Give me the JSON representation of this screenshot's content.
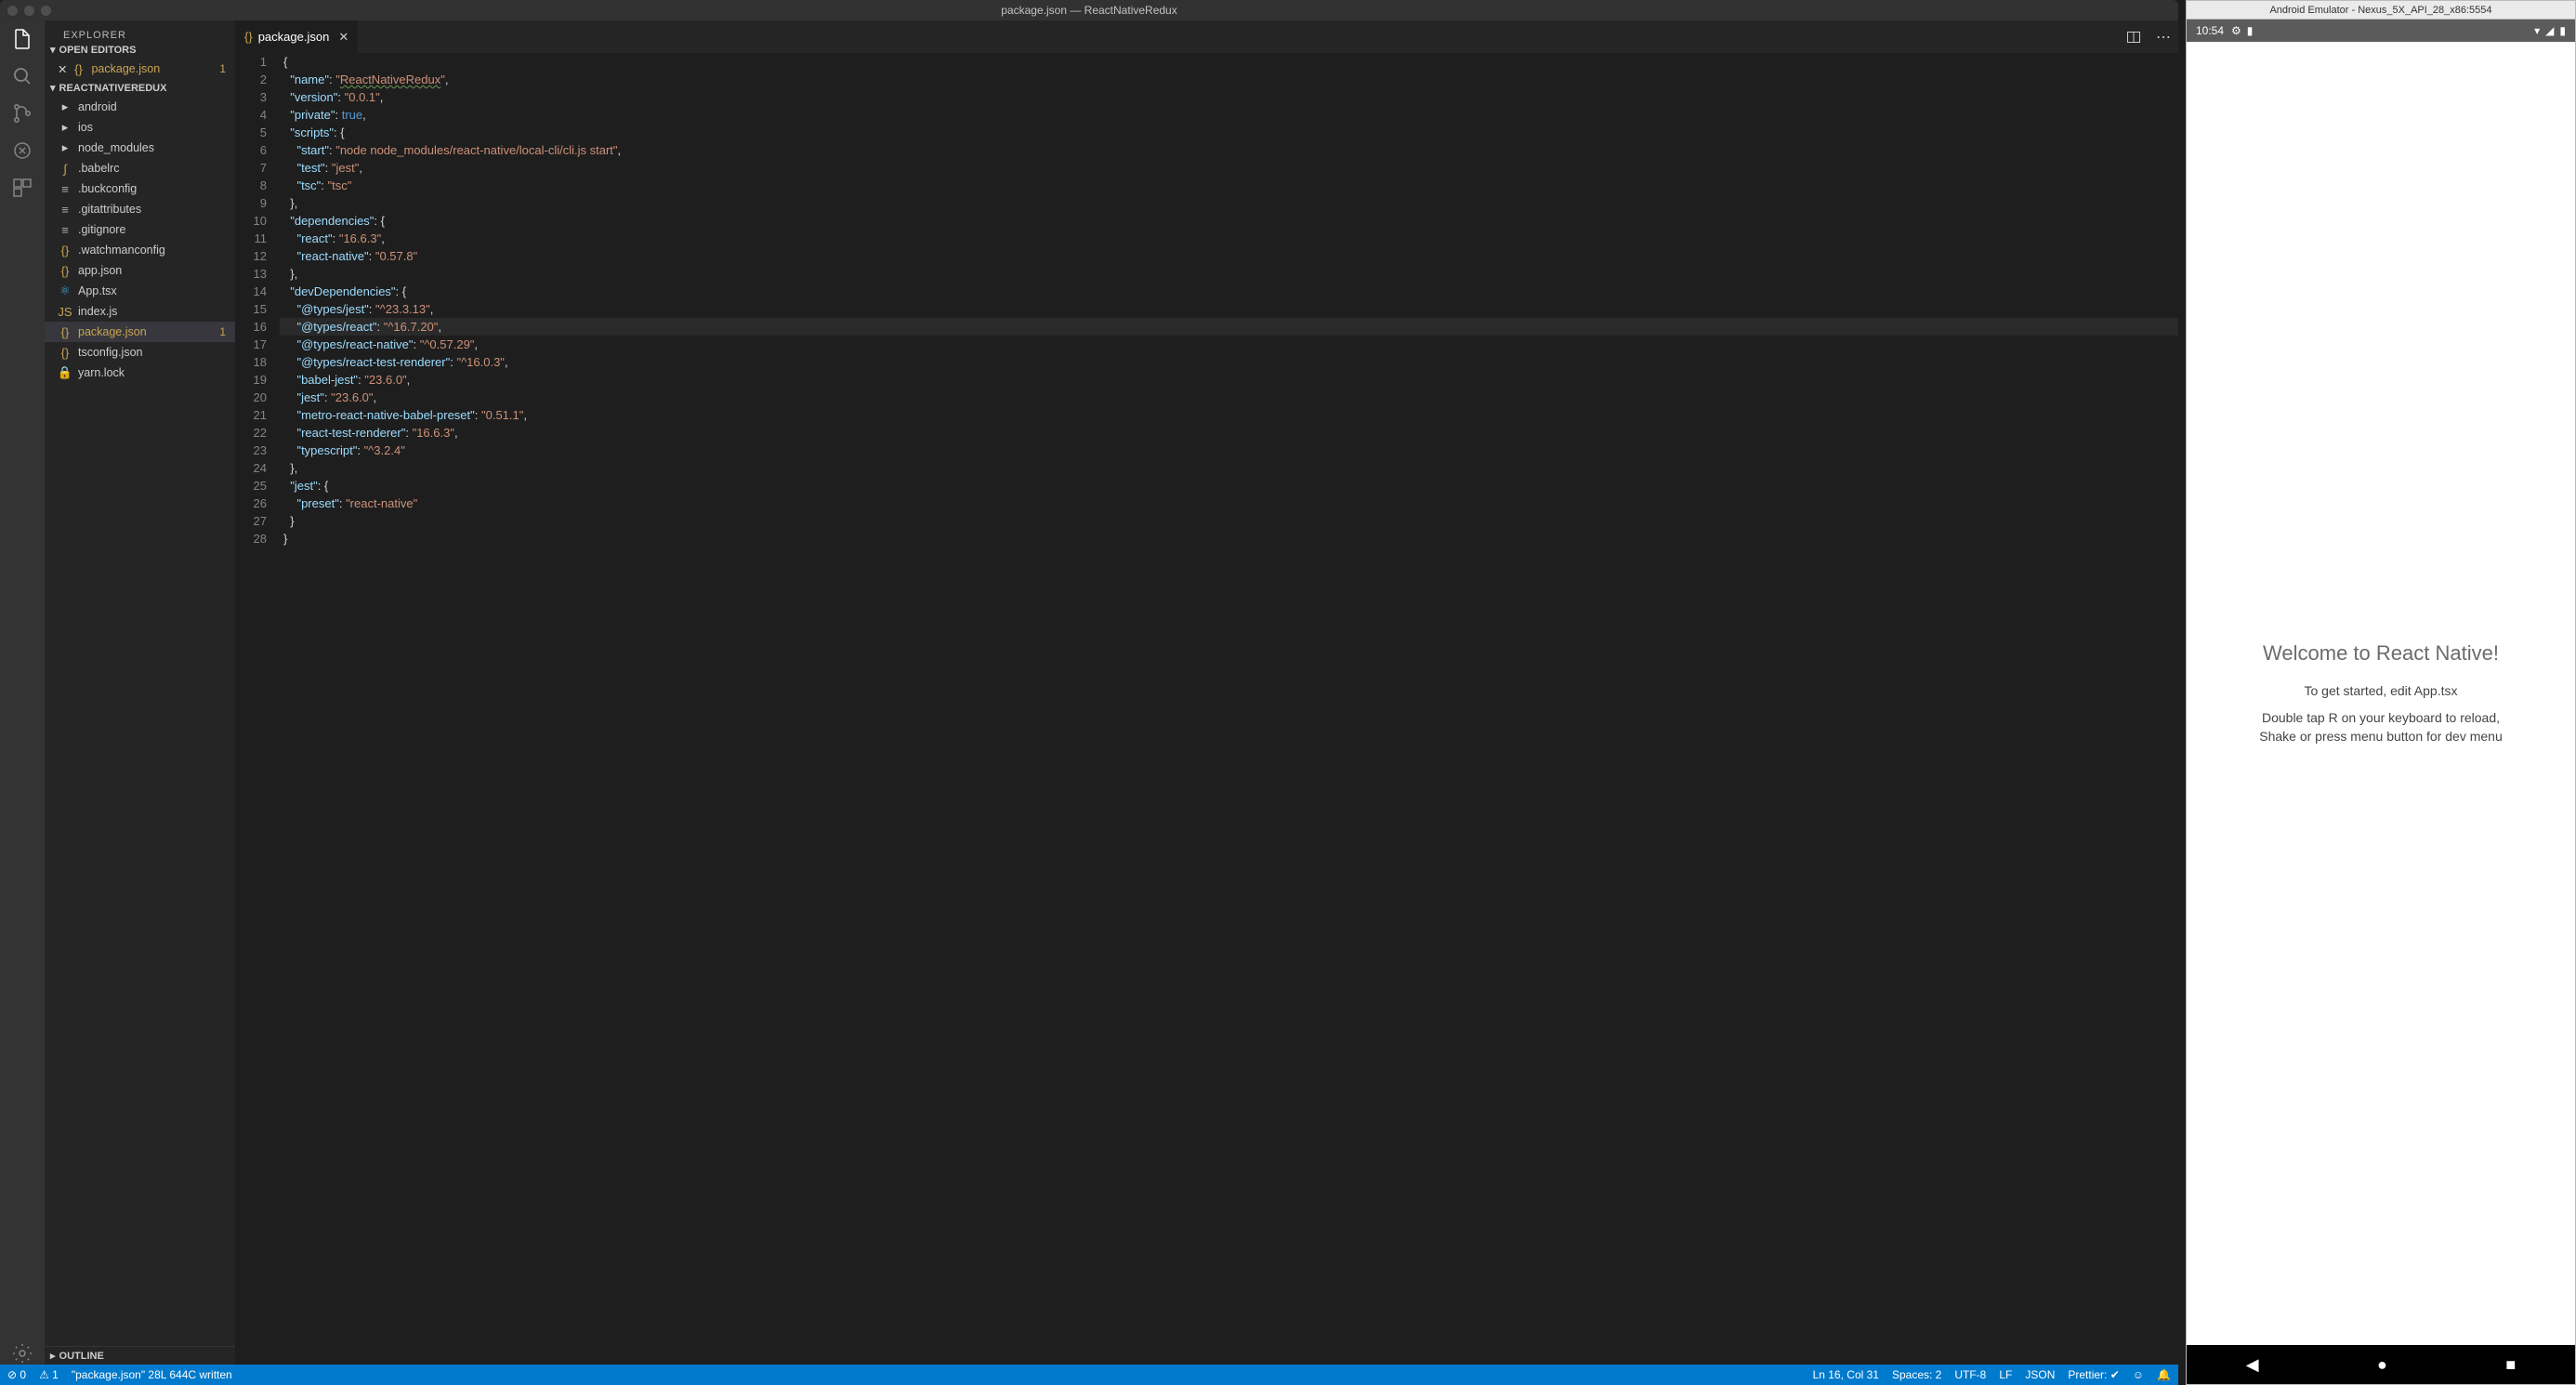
{
  "titlebar": "package.json — ReactNativeRedux",
  "sidebar": {
    "title": "EXPLORER",
    "sections": {
      "openEditors": "OPEN EDITORS",
      "project": "REACTNATIVEREDUX",
      "outline": "OUTLINE"
    },
    "openEditor": {
      "label": "package.json",
      "badge": "1"
    },
    "files": [
      {
        "label": "android",
        "icon": "folder"
      },
      {
        "label": "ios",
        "icon": "folder"
      },
      {
        "label": "node_modules",
        "icon": "folder"
      },
      {
        "label": ".babelrc",
        "icon": "babel"
      },
      {
        "label": ".buckconfig",
        "icon": "config"
      },
      {
        "label": ".gitattributes",
        "icon": "config"
      },
      {
        "label": ".gitignore",
        "icon": "config"
      },
      {
        "label": ".watchmanconfig",
        "icon": "json"
      },
      {
        "label": "app.json",
        "icon": "json"
      },
      {
        "label": "App.tsx",
        "icon": "react"
      },
      {
        "label": "index.js",
        "icon": "js"
      },
      {
        "label": "package.json",
        "icon": "json",
        "modified": true,
        "selected": true,
        "badge": "1"
      },
      {
        "label": "tsconfig.json",
        "icon": "json"
      },
      {
        "label": "yarn.lock",
        "icon": "lock"
      }
    ]
  },
  "tab": {
    "icon": "{}",
    "label": "package.json"
  },
  "code": [
    "{",
    "  \"name\": \"ReactNativeRedux\",",
    "  \"version\": \"0.0.1\",",
    "  \"private\": true,",
    "  \"scripts\": {",
    "    \"start\": \"node node_modules/react-native/local-cli/cli.js start\",",
    "    \"test\": \"jest\",",
    "    \"tsc\": \"tsc\"",
    "  },",
    "  \"dependencies\": {",
    "    \"react\": \"16.6.3\",",
    "    \"react-native\": \"0.57.8\"",
    "  },",
    "  \"devDependencies\": {",
    "    \"@types/jest\": \"^23.3.13\",",
    "    \"@types/react\": \"^16.7.20\",",
    "    \"@types/react-native\": \"^0.57.29\",",
    "    \"@types/react-test-renderer\": \"^16.0.3\",",
    "    \"babel-jest\": \"23.6.0\",",
    "    \"jest\": \"23.6.0\",",
    "    \"metro-react-native-babel-preset\": \"0.51.1\",",
    "    \"react-test-renderer\": \"16.6.3\",",
    "    \"typescript\": \"^3.2.4\"",
    "  },",
    "  \"jest\": {",
    "    \"preset\": \"react-native\"",
    "  }",
    "}"
  ],
  "highlightLine": 16,
  "statusbar": {
    "errors": "0",
    "warnings": "1",
    "message": "\"package.json\" 28L 644C written",
    "pos": "Ln 16, Col 31",
    "spaces": "Spaces: 2",
    "encoding": "UTF-8",
    "eol": "LF",
    "lang": "JSON",
    "prettier": "Prettier: ✔"
  },
  "emulator": {
    "title": "Android Emulator - Nexus_5X_API_28_x86:5554",
    "clock": "10:54",
    "heading": "Welcome to React Native!",
    "line1": "To get started, edit App.tsx",
    "line2": "Double tap R on your keyboard to reload,",
    "line3": "Shake or press menu button for dev menu"
  }
}
